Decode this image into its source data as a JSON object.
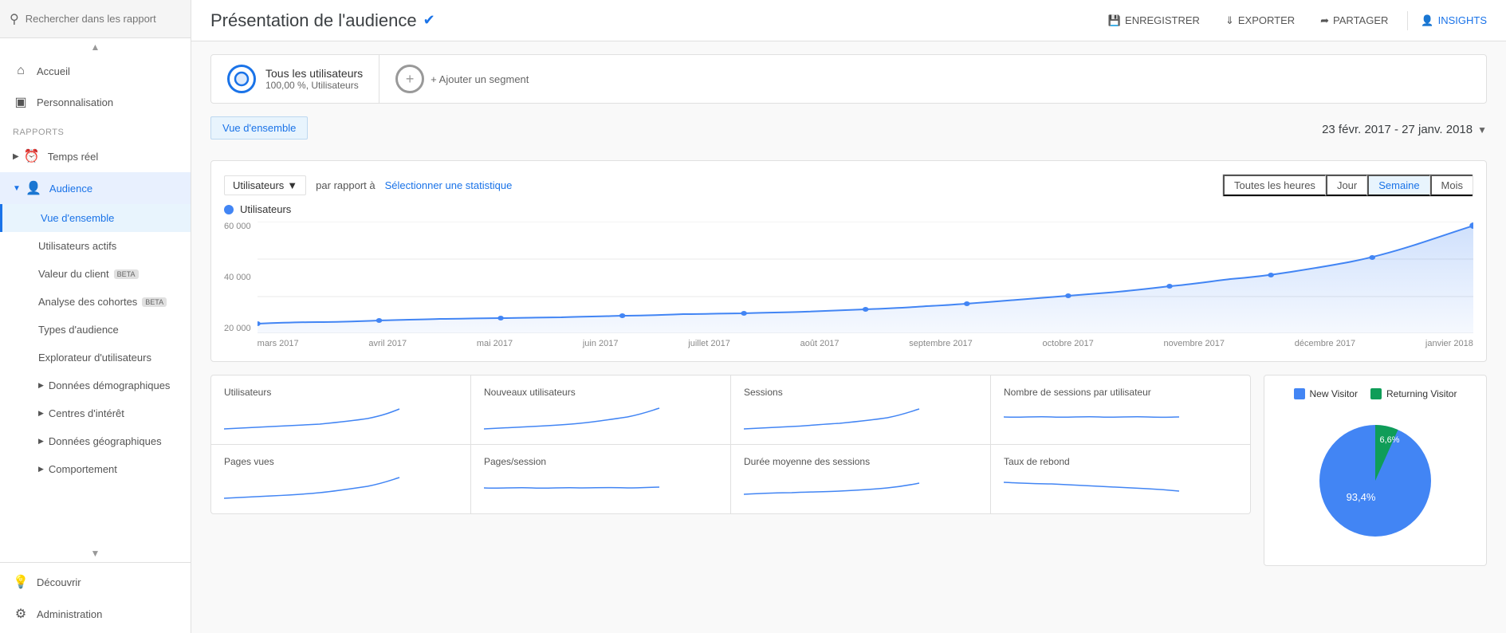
{
  "sidebar": {
    "search_placeholder": "Rechercher dans les rapport",
    "items": {
      "accueil": "Accueil",
      "personnalisation": "Personnalisation",
      "rapports_label": "RAPPORTS",
      "temps_reel": "Temps réel",
      "audience": "Audience",
      "vue_densemble": "Vue d'ensemble",
      "utilisateurs_actifs": "Utilisateurs actifs",
      "valeur_du_client": "Valeur du client",
      "analyse_des_cohortes": "Analyse des cohortes",
      "types_daudience": "Types d'audience",
      "explorateur": "Explorateur d'utilisateurs",
      "donnees_demo": "Données démographiques",
      "centres_dinteret": "Centres d'intérêt",
      "donnees_geo": "Données géographiques",
      "comportement": "Comportement",
      "decouvrir": "Découvrir",
      "administration": "Administration"
    }
  },
  "header": {
    "title": "Présentation de l'audience",
    "enregistrer": "ENREGISTRER",
    "exporter": "EXPORTER",
    "partager": "PARTAGER",
    "insights": "INSIGHTS"
  },
  "segment": {
    "tous_label": "Tous les utilisateurs",
    "tous_pct": "100,00 %, Utilisateurs",
    "ajouter": "+ Ajouter un segment"
  },
  "date_range": "23 févr. 2017 - 27 janv. 2018",
  "tabs": {
    "vue_ensemble": "Vue d'ensemble"
  },
  "chart_controls": {
    "metric": "Utilisateurs",
    "par_rapport_a": "par rapport à",
    "selectionner": "Sélectionner une statistique",
    "toutes_heures": "Toutes les heures",
    "jour": "Jour",
    "semaine": "Semaine",
    "mois": "Mois"
  },
  "chart": {
    "legend": "Utilisateurs",
    "y_labels": [
      "60 000",
      "40 000",
      "20 000"
    ],
    "x_labels": [
      "mars 2017",
      "avril 2017",
      "mai 2017",
      "juin 2017",
      "juillet 2017",
      "août 2017",
      "septembre 2017",
      "octobre 2017",
      "novembre 2017",
      "décembre 2017",
      "janvier 2018"
    ]
  },
  "stats": [
    {
      "label": "Utilisateurs"
    },
    {
      "label": "Nouveaux utilisateurs"
    },
    {
      "label": "Sessions"
    },
    {
      "label": "Nombre de sessions par utilisateur"
    },
    {
      "label": "Pages vues"
    },
    {
      "label": "Pages/session"
    },
    {
      "label": "Durée moyenne des sessions"
    },
    {
      "label": "Taux de rebond"
    }
  ],
  "pie": {
    "new_visitor_label": "New Visitor",
    "returning_visitor_label": "Returning Visitor",
    "new_pct": "93,4%",
    "returning_pct": "6,6%",
    "new_color": "#4285F4",
    "returning_color": "#0F9D58"
  }
}
